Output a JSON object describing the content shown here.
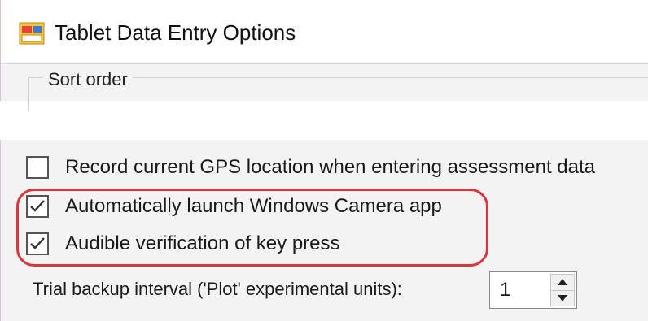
{
  "window": {
    "title": "Tablet Data Entry Options",
    "icon": "app-form-icon"
  },
  "sort_group": {
    "legend": "Sort order"
  },
  "options": [
    {
      "label": "Record current GPS location when entering assessment data",
      "checked": false
    },
    {
      "label": "Automatically launch Windows Camera app",
      "checked": true
    },
    {
      "label": "Audible verification of key press",
      "checked": true
    }
  ],
  "backup": {
    "label": "Trial backup interval ('Plot' experimental units):",
    "value": "1"
  },
  "colors": {
    "highlight": "#d9363e",
    "panel_bg": "#f3f3f3"
  }
}
